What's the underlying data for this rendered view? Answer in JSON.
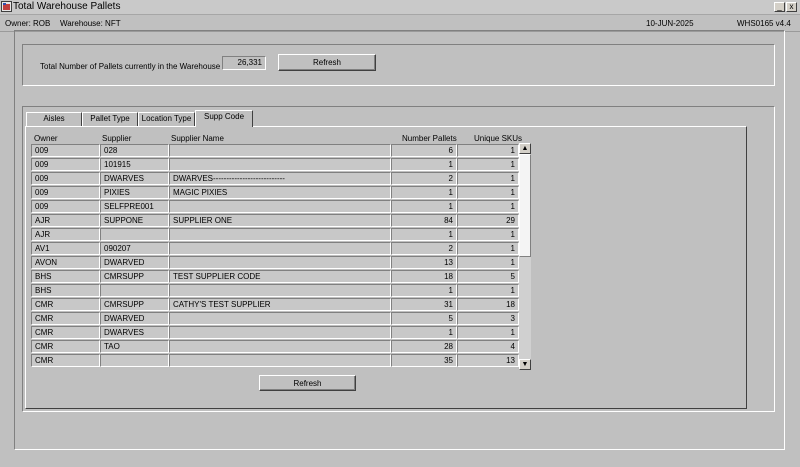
{
  "window": {
    "title": "Total Warehouse Pallets",
    "minimize": "_",
    "close": "x"
  },
  "info": {
    "owner": "Owner:  ROB",
    "warehouse": "Warehouse:  NFT",
    "date": "10-JUN-2025",
    "version": "WHS0165  v4.4"
  },
  "summary": {
    "label": "Total Number of Pallets currently in the Warehouse",
    "count": "26,331",
    "refresh_label": "Refresh"
  },
  "tabs": [
    "Aisles",
    "Pallet Type",
    "Location Type",
    "Supp Code"
  ],
  "active_tab": "Supp Code",
  "table": {
    "headers": {
      "owner": "Owner",
      "supplier": "Supplier",
      "supplier_name": "Supplier Name",
      "pallets": "Number Pallets",
      "skus": "Unique SKUs"
    },
    "rows": [
      [
        "009",
        "028",
        "",
        "6",
        "1"
      ],
      [
        "009",
        "101915",
        "",
        "1",
        "1"
      ],
      [
        "009",
        "DWARVES",
        "DWARVES---------------------------",
        "2",
        "1"
      ],
      [
        "009",
        "PIXIES",
        "MAGIC PIXIES",
        "1",
        "1"
      ],
      [
        "009",
        "SELFPRE001",
        "",
        "1",
        "1"
      ],
      [
        "AJR",
        "SUPPONE",
        "SUPPLIER ONE",
        "84",
        "29"
      ],
      [
        "AJR",
        "",
        "",
        "1",
        "1"
      ],
      [
        "AV1",
        "090207",
        "",
        "2",
        "1"
      ],
      [
        "AVON",
        "DWARVED",
        "",
        "13",
        "1"
      ],
      [
        "BHS",
        "CMRSUPP",
        "TEST SUPPLIER CODE",
        "18",
        "5"
      ],
      [
        "BHS",
        "",
        "",
        "1",
        "1"
      ],
      [
        "CMR",
        "CMRSUPP",
        "CATHY'S TEST SUPPLIER",
        "31",
        "18"
      ],
      [
        "CMR",
        "DWARVED",
        "",
        "5",
        "3"
      ],
      [
        "CMR",
        "DWARVES",
        "",
        "1",
        "1"
      ],
      [
        "CMR",
        "TAO",
        "",
        "28",
        "4"
      ],
      [
        "CMR",
        "",
        "",
        "35",
        "13"
      ]
    ],
    "refresh_label": "Refresh"
  },
  "icons": {
    "app": "app-icon",
    "scroll_up": "scroll-up-arrow-icon",
    "scroll_down": "scroll-down-arrow-icon"
  }
}
